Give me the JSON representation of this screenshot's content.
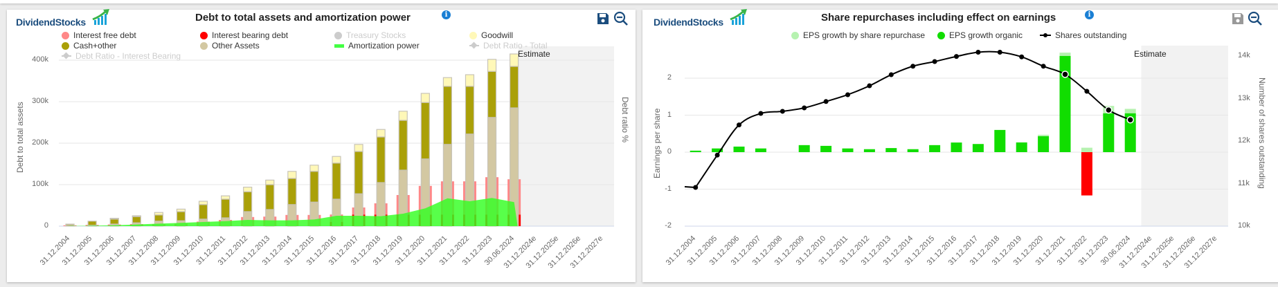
{
  "left": {
    "logo": "DividendStocks",
    "title": "Debt to total assets and amortization power",
    "info_icon": "info-circle-icon",
    "save_icon": "save-icon",
    "zoom_icon": "zoom-out-icon",
    "legend": [
      {
        "label": "Interest free debt",
        "color": "#ff8888",
        "visible": true
      },
      {
        "label": "Interest bearing debt",
        "color": "#ff0000",
        "visible": true
      },
      {
        "label": "Treasury Stocks",
        "color": "#cccccc",
        "visible": false
      },
      {
        "label": "Goodwill",
        "color": "#fff8b8",
        "visible": true
      },
      {
        "label": "Cash+other",
        "color": "#aaa008",
        "visible": true
      },
      {
        "label": "Other Assets",
        "color": "#d3c8a2",
        "visible": true
      },
      {
        "label": "Amortization power",
        "color": "#44ff44",
        "visible": true
      },
      {
        "label": "Debt Ratio - Total",
        "color": "#cccccc",
        "visible": false
      },
      {
        "label": "Debt Ratio - Interest Bearing",
        "color": "#cccccc",
        "visible": false
      }
    ],
    "estimate_label": "Estimate",
    "chart_data": {
      "type": "bar",
      "categories": [
        "31.12.2004",
        "31.12.2005",
        "31.12.2006",
        "31.12.2007",
        "31.12.2008",
        "31.12.2009",
        "31.12.2010",
        "31.12.2011",
        "31.12.2012",
        "31.12.2013",
        "31.12.2014",
        "31.12.2015",
        "31.12.2016",
        "31.12.2017",
        "31.12.2018",
        "31.12.2019",
        "31.12.2020",
        "31.12.2021",
        "31.12.2022",
        "31.12.2023",
        "30.06.2024",
        "31.12.2024e",
        "31.12.2025e",
        "31.12.2026e",
        "31.12.2027e"
      ],
      "ylabel": "Debt to total assets",
      "y2label": "Debt ratio %",
      "yticks": [
        "0",
        "100k",
        "200k",
        "300k",
        "400k"
      ],
      "ylim": [
        0,
        400000
      ],
      "grid": true,
      "legend_position": "top",
      "estimate_from": "31.12.2024e",
      "series": [
        {
          "name": "Other Assets",
          "stack": "assets",
          "values": [
            1000,
            2000,
            5000,
            8000,
            12000,
            13000,
            17000,
            20000,
            35000,
            40000,
            52000,
            58000,
            65000,
            78000,
            105000,
            135000,
            162000,
            197000,
            222000,
            262000,
            285000
          ]
        },
        {
          "name": "Cash+other",
          "stack": "assets",
          "values": [
            3000,
            10000,
            12000,
            15000,
            15000,
            22000,
            35000,
            45000,
            48000,
            60000,
            63000,
            74000,
            87000,
            102000,
            110000,
            120000,
            136000,
            140000,
            115000,
            111000,
            100000
          ]
        },
        {
          "name": "Goodwill",
          "stack": "assets",
          "values": [
            1000,
            0,
            2000,
            2000,
            6000,
            6000,
            8000,
            8000,
            11000,
            11000,
            17000,
            15000,
            16000,
            17000,
            18000,
            22000,
            22000,
            21000,
            28000,
            29000,
            30000
          ]
        },
        {
          "name": "Interest bearing debt",
          "stack": "debt",
          "values": [
            0,
            0,
            0,
            0,
            0,
            0,
            0,
            0,
            0,
            0,
            0,
            0,
            10000,
            28000,
            28000,
            28000,
            28000,
            28000,
            28000,
            28000,
            28000
          ]
        },
        {
          "name": "Interest free debt",
          "stack": "debt",
          "values": [
            2000,
            3000,
            4000,
            5000,
            5000,
            6000,
            11000,
            15000,
            22000,
            23000,
            27000,
            27000,
            18000,
            17000,
            27000,
            47000,
            69000,
            80000,
            80000,
            90000,
            85000
          ]
        },
        {
          "name": "Amortization power",
          "type": "area",
          "values": [
            500,
            1000,
            2000,
            4000,
            6000,
            8000,
            10000,
            12000,
            15000,
            14000,
            14000,
            16000,
            25000,
            25000,
            24000,
            30000,
            43000,
            67000,
            60000,
            68000,
            58000
          ]
        }
      ]
    }
  },
  "right": {
    "logo": "DividendStocks",
    "title": "Share repurchases including effect on earnings",
    "info_icon": "info-circle-icon",
    "save_icon": "save-icon",
    "zoom_icon": "zoom-out-icon",
    "legend": [
      {
        "label": "EPS growth by share repurchase",
        "color": "#b6f2b0",
        "type": "dot"
      },
      {
        "label": "EPS growth organic",
        "color": "#11dd00",
        "type": "dot"
      },
      {
        "label": "Shares outstanding",
        "color": "#000000",
        "type": "line"
      }
    ],
    "estimate_label": "Estimate",
    "chart_data": {
      "type": "bar",
      "categories": [
        "31.12.2004",
        "31.12.2005",
        "31.12.2006",
        "31.12.2007",
        "31.12.2008",
        "31.12.2009",
        "31.12.2010",
        "31.12.2011",
        "31.12.2012",
        "31.12.2013",
        "31.12.2014",
        "31.12.2015",
        "31.12.2016",
        "31.12.2017",
        "31.12.2018",
        "31.12.2019",
        "31.12.2020",
        "31.12.2021",
        "31.12.2022",
        "31.12.2023",
        "30.06.2024",
        "31.12.2024e",
        "31.12.2025e",
        "31.12.2026e",
        "31.12.2027e"
      ],
      "ylabel": "Earnings per share",
      "y2label": "Number of shares outstanding",
      "yticks": [
        "-2",
        "-1",
        "0",
        "1",
        "2"
      ],
      "y2ticks": [
        "10k",
        "11k",
        "12k",
        "13k",
        "14k"
      ],
      "ylim": [
        -2,
        2
      ],
      "y2lim": [
        10000,
        14000
      ],
      "grid": true,
      "legend_position": "top",
      "estimate_from": "31.12.2024e",
      "negative_color": "#ff0000",
      "series": [
        {
          "name": "EPS growth organic",
          "values": [
            0.04,
            0.1,
            0.15,
            0.1,
            0,
            0.19,
            0.17,
            0.1,
            0.08,
            0.11,
            0.08,
            0.19,
            0.26,
            0.22,
            0.6,
            0.26,
            0.43,
            2.6,
            -1.17,
            1.05,
            1.05
          ]
        },
        {
          "name": "EPS growth by share repurchase",
          "values": [
            0,
            0,
            0,
            0,
            0,
            0,
            0,
            0,
            0,
            0,
            0,
            0,
            0,
            0,
            0,
            0.01,
            0.04,
            0.09,
            0.12,
            0.2,
            0.12
          ]
        },
        {
          "name": "Shares outstanding",
          "type": "line",
          "axis": "right",
          "values": [
            10910,
            11670,
            12380,
            12650,
            12700,
            12780,
            12930,
            13090,
            13300,
            13560,
            13760,
            13870,
            13990,
            14090,
            14090,
            13980,
            13760,
            13570,
            13170,
            12730,
            12500
          ]
        }
      ]
    }
  }
}
